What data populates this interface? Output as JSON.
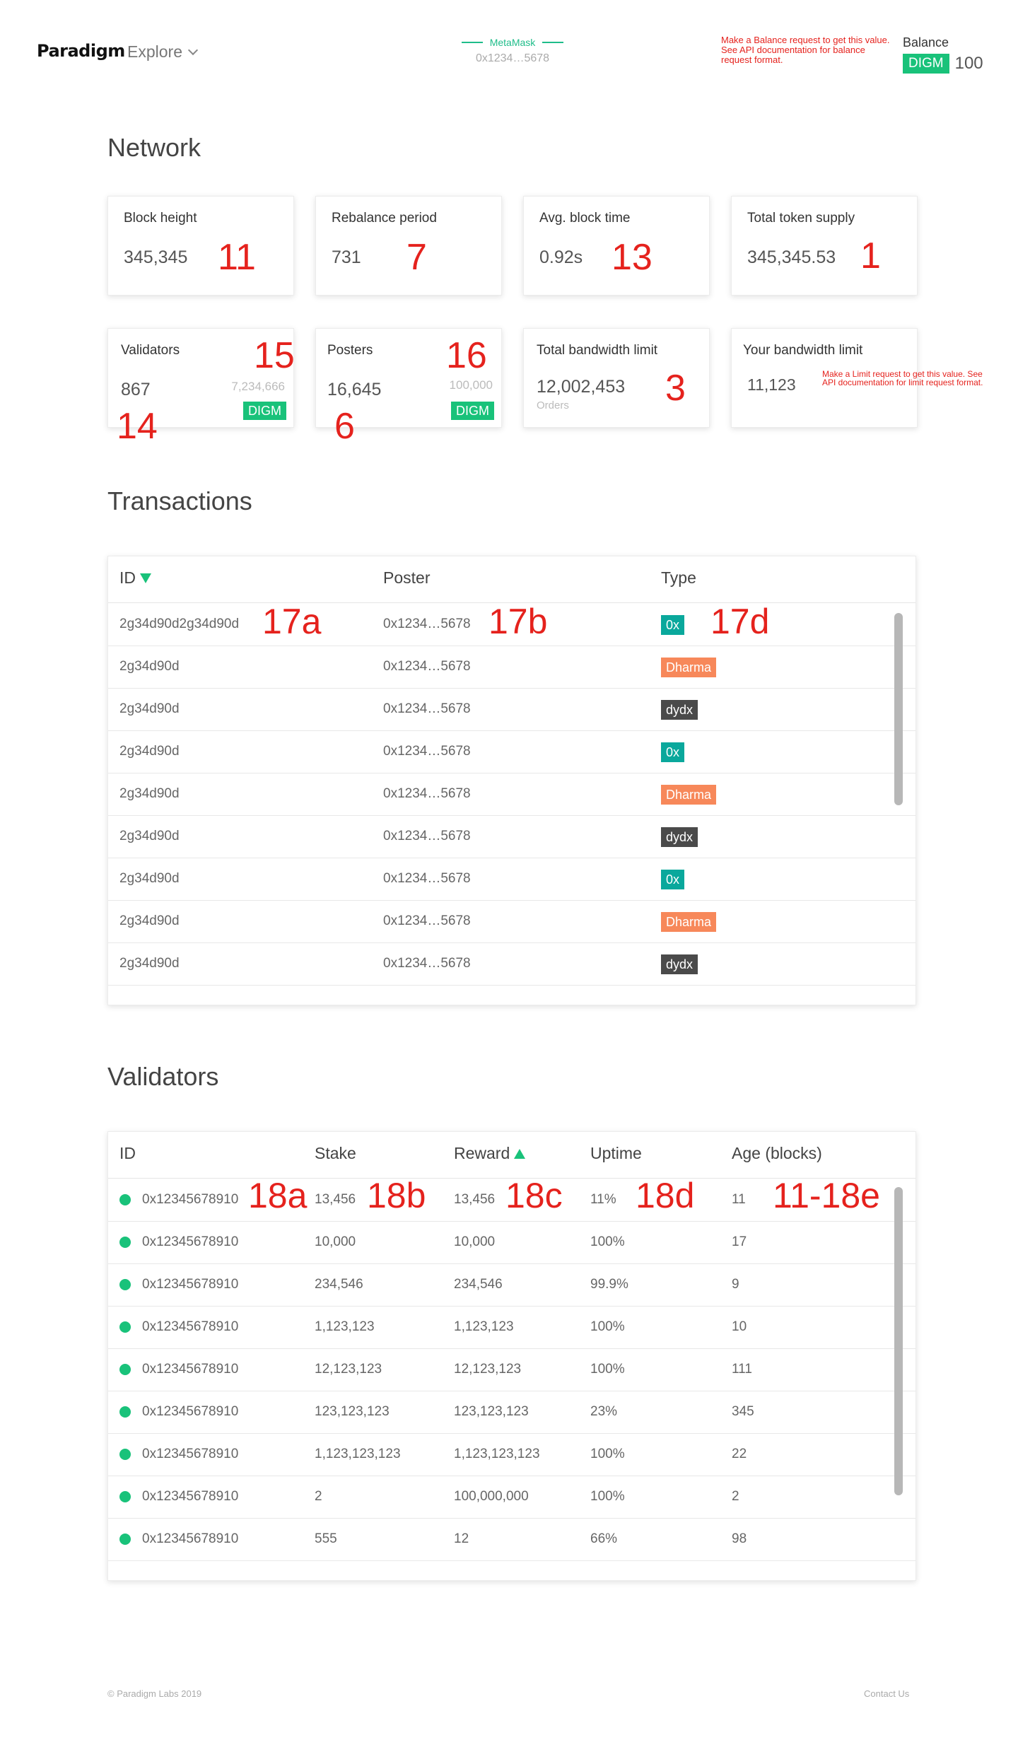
{
  "header": {
    "logo": "Paradigm",
    "explore": "Explore",
    "metamask_label": "MetaMask",
    "metamask_address": "0x1234…5678",
    "balance_note": "Make a Balance request to get this value. See API documentation for balance request format.",
    "balance_label": "Balance",
    "balance_token": "DIGM",
    "balance_value": "100"
  },
  "network": {
    "title": "Network",
    "cards": [
      {
        "title": "Block height",
        "value": "345,345",
        "anno": "11"
      },
      {
        "title": "Rebalance period",
        "value": "731",
        "anno": "7"
      },
      {
        "title": "Avg. block time",
        "value": "0.92s",
        "anno": "13"
      },
      {
        "title": "Total token supply",
        "value": "345,345.53",
        "anno": "1"
      },
      {
        "title": "Validators",
        "value": "867",
        "sub": "7,234,666",
        "token": "DIGM",
        "anno_top": "15",
        "anno_bottom": "14"
      },
      {
        "title": "Posters",
        "value": "16,645",
        "sub": "100,000",
        "token": "DIGM",
        "anno_top": "16",
        "anno_bottom": "6"
      },
      {
        "title": "Total bandwidth limit",
        "value": "12,002,453",
        "sub": "Orders",
        "anno": "3"
      },
      {
        "title": "Your bandwidth limit",
        "value": "11,123",
        "note": "Make a Limit request to get this value. See API documentation for limit request format."
      }
    ]
  },
  "transactions": {
    "title": "Transactions",
    "headers": [
      "ID",
      "Poster",
      "Type"
    ],
    "anno": [
      "17a",
      "17b",
      "17d"
    ],
    "rows": [
      {
        "id": "2g34d90d2g34d90d",
        "poster": "0x1234…5678",
        "type": "0x"
      },
      {
        "id": "2g34d90d",
        "poster": "0x1234…5678",
        "type": "Dharma"
      },
      {
        "id": "2g34d90d",
        "poster": "0x1234…5678",
        "type": "dydx"
      },
      {
        "id": "2g34d90d",
        "poster": "0x1234…5678",
        "type": "0x"
      },
      {
        "id": "2g34d90d",
        "poster": "0x1234…5678",
        "type": "Dharma"
      },
      {
        "id": "2g34d90d",
        "poster": "0x1234…5678",
        "type": "dydx"
      },
      {
        "id": "2g34d90d",
        "poster": "0x1234…5678",
        "type": "0x"
      },
      {
        "id": "2g34d90d",
        "poster": "0x1234…5678",
        "type": "Dharma"
      },
      {
        "id": "2g34d90d",
        "poster": "0x1234…5678",
        "type": "dydx"
      }
    ]
  },
  "validators": {
    "title": "Validators",
    "headers": [
      "ID",
      "Stake",
      "Reward",
      "Uptime",
      "Age (blocks)"
    ],
    "anno": [
      "18a",
      "18b",
      "18c",
      "18d",
      "11-18e"
    ],
    "rows": [
      {
        "id": "0x12345678910",
        "stake": "13,456",
        "reward": "13,456",
        "uptime": "11%",
        "age": "11"
      },
      {
        "id": "0x12345678910",
        "stake": "10,000",
        "reward": "10,000",
        "uptime": "100%",
        "age": "17"
      },
      {
        "id": "0x12345678910",
        "stake": "234,546",
        "reward": "234,546",
        "uptime": "99.9%",
        "age": "9"
      },
      {
        "id": "0x12345678910",
        "stake": "1,123,123",
        "reward": "1,123,123",
        "uptime": "100%",
        "age": "10"
      },
      {
        "id": "0x12345678910",
        "stake": "12,123,123",
        "reward": "12,123,123",
        "uptime": "100%",
        "age": "111"
      },
      {
        "id": "0x12345678910",
        "stake": "123,123,123",
        "reward": "123,123,123",
        "uptime": "23%",
        "age": "345"
      },
      {
        "id": "0x12345678910",
        "stake": "1,123,123,123",
        "reward": "1,123,123,123",
        "uptime": "100%",
        "age": "22"
      },
      {
        "id": "0x12345678910",
        "stake": "2",
        "reward": "100,000,000",
        "uptime": "100%",
        "age": "2"
      },
      {
        "id": "0x12345678910",
        "stake": "555",
        "reward": "12",
        "uptime": "66%",
        "age": "98"
      }
    ]
  },
  "footer": {
    "copyright": "© Paradigm Labs 2019",
    "contact": "Contact Us"
  },
  "colors": {
    "accent_green": "#19c27a",
    "badge_0x": "#0aa89c",
    "badge_dharma": "#f7885a",
    "badge_dydx": "#4a4a4a",
    "annotation_red": "#e5221d"
  }
}
